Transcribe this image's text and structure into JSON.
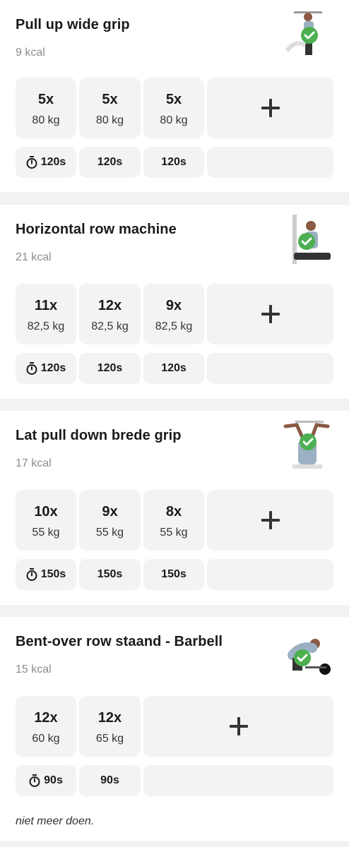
{
  "exercises": [
    {
      "title": "Pull up wide grip",
      "kcal": "9 kcal",
      "sets": [
        {
          "reps": "5x",
          "weight": "80 kg",
          "rest": "120s"
        },
        {
          "reps": "5x",
          "weight": "80 kg",
          "rest": "120s"
        },
        {
          "reps": "5x",
          "weight": "80 kg",
          "rest": "120s"
        }
      ]
    },
    {
      "title": "Horizontal row machine",
      "kcal": "21 kcal",
      "sets": [
        {
          "reps": "11x",
          "weight": "82,5 kg",
          "rest": "120s"
        },
        {
          "reps": "12x",
          "weight": "82,5 kg",
          "rest": "120s"
        },
        {
          "reps": "9x",
          "weight": "82,5 kg",
          "rest": "120s"
        }
      ]
    },
    {
      "title": "Lat pull down brede grip",
      "kcal": "17 kcal",
      "sets": [
        {
          "reps": "10x",
          "weight": "55 kg",
          "rest": "150s"
        },
        {
          "reps": "9x",
          "weight": "55 kg",
          "rest": "150s"
        },
        {
          "reps": "8x",
          "weight": "55 kg",
          "rest": "150s"
        }
      ]
    },
    {
      "title": "Bent-over row staand - Barbell",
      "kcal": "15 kcal",
      "sets": [
        {
          "reps": "12x",
          "weight": "60 kg",
          "rest": "90s"
        },
        {
          "reps": "12x",
          "weight": "65 kg",
          "rest": "90s"
        }
      ],
      "note": "niet meer doen."
    }
  ],
  "icons": {
    "timer": "stopwatch-icon",
    "add": "plus-icon",
    "done": "check-circle-icon"
  },
  "colors": {
    "check": "#4caf50",
    "cell_bg": "#f3f3f3",
    "separator": "#f2f2f2"
  }
}
